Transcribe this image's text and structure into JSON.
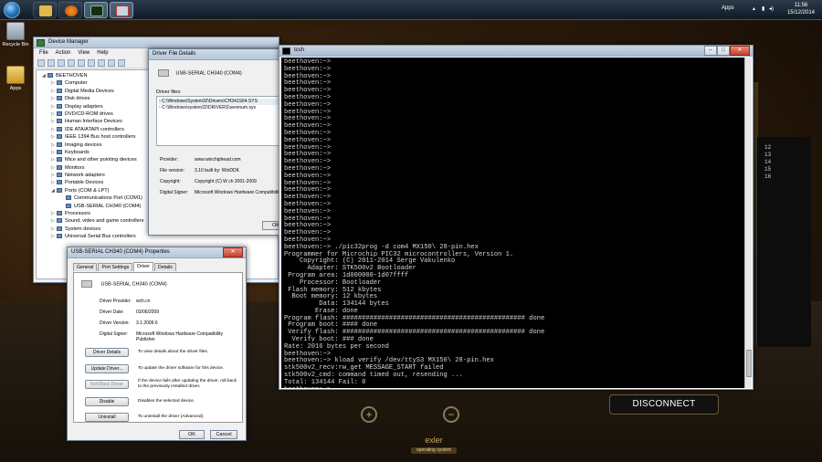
{
  "taskbar": {
    "apps_label": "Apps",
    "time": "11:56",
    "date": "15/12/2014"
  },
  "desktop": {
    "icons": [
      {
        "label": "Recycle Bin"
      },
      {
        "label": "Apps"
      }
    ]
  },
  "device_manager": {
    "title": "Device Manager",
    "menu": [
      "File",
      "Action",
      "View",
      "Help"
    ],
    "tree": [
      {
        "label": "BEETHOVEN",
        "expander": "◢",
        "level": 0
      },
      {
        "label": "Computer",
        "expander": "▷",
        "level": 1
      },
      {
        "label": "Digital Media Devices",
        "expander": "▷",
        "level": 1
      },
      {
        "label": "Disk drives",
        "expander": "▷",
        "level": 1
      },
      {
        "label": "Display adapters",
        "expander": "▷",
        "level": 1
      },
      {
        "label": "DVD/CD-ROM drives",
        "expander": "▷",
        "level": 1
      },
      {
        "label": "Human Interface Devices",
        "expander": "▷",
        "level": 1
      },
      {
        "label": "IDE ATA/ATAPI controllers",
        "expander": "▷",
        "level": 1
      },
      {
        "label": "IEEE 1394 Bus host controllers",
        "expander": "▷",
        "level": 1
      },
      {
        "label": "Imaging devices",
        "expander": "▷",
        "level": 1
      },
      {
        "label": "Keyboards",
        "expander": "▷",
        "level": 1
      },
      {
        "label": "Mice and other pointing devices",
        "expander": "▷",
        "level": 1
      },
      {
        "label": "Monitors",
        "expander": "▷",
        "level": 1
      },
      {
        "label": "Network adapters",
        "expander": "▷",
        "level": 1
      },
      {
        "label": "Portable Devices",
        "expander": "▷",
        "level": 1
      },
      {
        "label": "Ports (COM & LPT)",
        "expander": "◢",
        "level": 1
      },
      {
        "label": "Communications Port (COM1)",
        "expander": "",
        "level": 2
      },
      {
        "label": "USB-SERIAL CH340 (COM4)",
        "expander": "",
        "level": 2
      },
      {
        "label": "Processors",
        "expander": "▷",
        "level": 1
      },
      {
        "label": "Sound, video and game controllers",
        "expander": "▷",
        "level": 1
      },
      {
        "label": "System devices",
        "expander": "▷",
        "level": 1
      },
      {
        "label": "Universal Serial Bus controllers",
        "expander": "▷",
        "level": 1
      }
    ]
  },
  "driver_file_details": {
    "title": "Driver File Details",
    "device": "USB-SERIAL CH340 (COM4)",
    "files_label": "Driver files:",
    "files": [
      "C:\\Windows\\System32\\Drivers\\CH341S64.SYS",
      "C:\\Windows\\system32\\DRIVERS\\serenum.sys"
    ],
    "provider_label": "Provider:",
    "provider": "www.winchiphead.com",
    "file_version_label": "File version:",
    "file_version": "3.10 built by: WinDDK",
    "copyright_label": "Copyright:",
    "copyright": "Copyright (C) W ch 2001-2009",
    "signer_label": "Digital Signer:",
    "signer": "Microsoft Windows Hardware Compatibility",
    "ok": "OK"
  },
  "properties": {
    "title": "USB-SERIAL CH340 (COM4) Properties",
    "tabs": [
      "General",
      "Port Settings",
      "Driver",
      "Details"
    ],
    "device": "USB-SERIAL CH340 (COM4)",
    "provider_label": "Driver Provider:",
    "provider": "wch.cn",
    "date_label": "Driver Date:",
    "date": "03/06/2009",
    "version_label": "Driver Version:",
    "version": "3.1.2009.6",
    "signer_label": "Digital Signer:",
    "signer": "Microsoft Windows Hardware Compatibility Publisher",
    "buttons": [
      {
        "label": "Driver Details",
        "desc": "To view details about the driver files."
      },
      {
        "label": "Update Driver...",
        "desc": "To update the driver software for this device."
      },
      {
        "label": "Roll Back Driver",
        "desc": "If the device fails after updating the driver, roll back to the previously installed driver."
      },
      {
        "label": "Disable",
        "desc": "Disables the selected device."
      },
      {
        "label": "Uninstall",
        "desc": "To uninstall the driver (Advanced)."
      }
    ],
    "ok": "OK",
    "cancel": "Cancel"
  },
  "terminal": {
    "title": "tcsh",
    "lines": [
      "beethoven:~>",
      "beethoven:~>",
      "beethoven:~>",
      "beethoven:~>",
      "beethoven:~>",
      "beethoven:~>",
      "beethoven:~>",
      "beethoven:~>",
      "beethoven:~>",
      "beethoven:~>",
      "beethoven:~>",
      "beethoven:~>",
      "beethoven:~>",
      "beethoven:~>",
      "beethoven:~>",
      "beethoven:~>",
      "beethoven:~>",
      "beethoven:~>",
      "beethoven:~>",
      "beethoven:~>",
      "beethoven:~>",
      "beethoven:~>",
      "beethoven:~>",
      "beethoven:~>",
      "beethoven:~>",
      "beethoven:~>",
      "beethoven:~> ./pic32prog -d com4 MX150\\ 28-pin.hex",
      "Programmer for Microchip PIC32 microcontrollers, Version 1.",
      "    Copyright: (C) 2011-2014 Serge Vakulenko",
      "      Adapter: STK500v2 Bootloader",
      " Program area: 1d000000-1d07ffff",
      "    Processor: Bootloader",
      " Flash memory: 512 kbytes",
      "  Boot memory: 12 kbytes",
      "         Data: 134144 bytes",
      "        Erase: done",
      "Program flash: ############################################### done",
      " Program boot: #### done",
      " Verify flash: ############################################### done",
      "  Verify boot: ### done",
      "Rate: 2016 bytes per second",
      "beethoven:~>",
      "beethoven:~> kload verify /dev/ttyS3 MX150\\ 28-pin.hex",
      "stk500v2_recv:rw_get MESSAGE_START failed",
      "stk500v2_cmd: command timed out, resending ...",
      "Total: 134144 Fail: 0",
      "beethoven:~>"
    ]
  },
  "app_panel": {
    "disconnect": "DISCONNECT",
    "plus": "+",
    "minus": "−",
    "brand": "exler",
    "tagline": "operating system",
    "side_numbers": [
      "12",
      "13",
      "14",
      "15",
      "16"
    ]
  }
}
